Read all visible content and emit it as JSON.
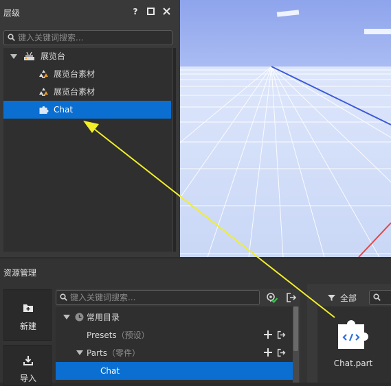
{
  "hierarchy": {
    "title": "层级",
    "controls": {
      "help": "?",
      "maximize": "□",
      "close": "✕"
    },
    "search_placeholder": "键入关键词搜索...",
    "items": [
      {
        "label": "展览台",
        "icon": "exhibit-stand-icon",
        "expanded": true
      },
      {
        "label": "展览台素材",
        "icon": "material-icon"
      },
      {
        "label": "展览台素材",
        "icon": "material-icon"
      },
      {
        "label": "Chat",
        "icon": "puzzle-part-icon",
        "selected": true
      }
    ]
  },
  "assets": {
    "title": "资源管理",
    "buttons": [
      {
        "label": "新建",
        "icon": "new-folder-icon"
      },
      {
        "label": "导入",
        "icon": "import-icon"
      }
    ],
    "search_placeholder": "键入关键词搜索...",
    "tree": {
      "root": {
        "label": "常用目录",
        "icon": "clock-icon"
      },
      "items": [
        {
          "label": "Presets",
          "sub": "（预设）"
        },
        {
          "label": "Parts",
          "sub": "（零件）",
          "expanded": true
        },
        {
          "label": "Chat",
          "selected": true
        }
      ]
    },
    "filter_label": "全部",
    "file": {
      "name": "Chat.part",
      "icon": "part-file-icon"
    }
  },
  "colors": {
    "selection": "#0a6fd1",
    "arrow": "#f2ef28",
    "panel_bg": "#393939",
    "viewport_sky": "#c7d6f7"
  }
}
